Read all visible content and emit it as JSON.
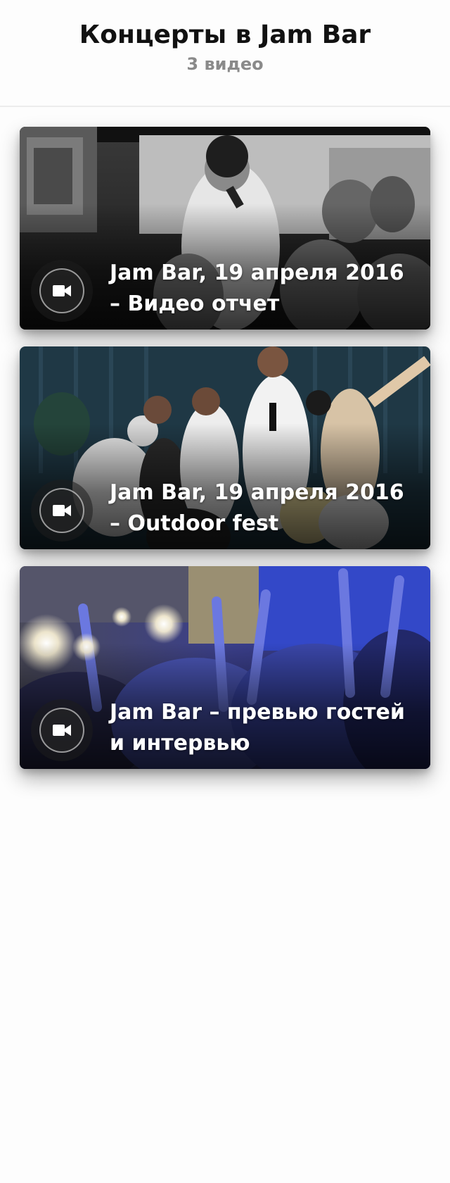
{
  "header": {
    "title": "Концерты в Jam Bar",
    "count": "3 видео"
  },
  "videos": [
    {
      "title": "Jam Bar, 19 апреля 2016 – Видео отчет",
      "icon": "video-camera-icon"
    },
    {
      "title": "Jam Bar, 19 апреля 2016 – Outdoor fest",
      "icon": "video-camera-icon"
    },
    {
      "title": "Jam Bar – превью гостей и интервью",
      "icon": "video-camera-icon"
    }
  ],
  "colors": {
    "background": "#fdfdfd",
    "subtitle": "#8a8a8a",
    "divider": "#ececec"
  }
}
